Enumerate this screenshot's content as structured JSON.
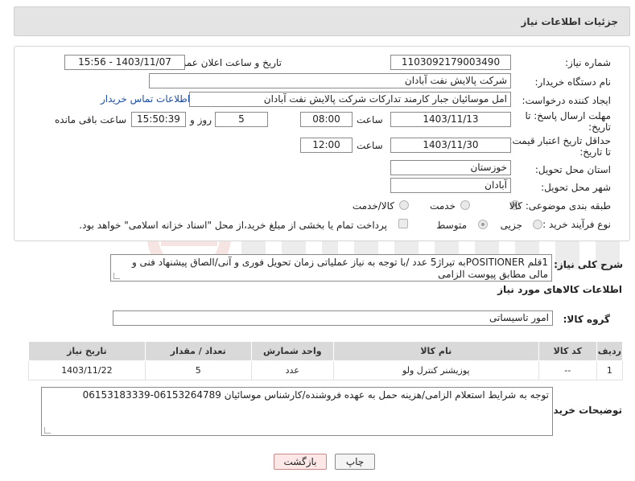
{
  "header": {
    "title": "جزئیات اطلاعات نیاز"
  },
  "form": {
    "need_number_label": "شماره نیاز:",
    "need_number": "1103092179003490",
    "announce_label": "تاریخ و ساعت اعلان عمومی:",
    "announce_value": "1403/11/07 - 15:56",
    "buyer_label": "نام دستگاه خریدار:",
    "buyer_value": "شرکت پالایش نفت آبادان",
    "requester_label": "ایجاد کننده درخواست:",
    "requester_value": "امل موسائیان جبار کارمند تدارکات شرکت پالایش نفت آبادان",
    "contact_link": "اطلاعات تماس خریدار",
    "deadline_label": "مهلت ارسال پاسخ: تا تاریخ:",
    "deadline_date": "1403/11/13",
    "time_label": "ساعت",
    "deadline_time": "08:00",
    "days_value": "5",
    "days_label": "روز و",
    "remaining_time": "15:50:39",
    "remaining_label": "ساعت باقی مانده",
    "validity_label": "حداقل تاریخ اعتبار قیمت: تا تاریخ:",
    "validity_date": "1403/11/30",
    "validity_time_label": "ساعت",
    "validity_time": "12:00",
    "province_label": "استان محل تحویل:",
    "province_value": "خوزستان",
    "city_label": "شهر محل تحویل:",
    "city_value": "آبادان",
    "category_label": "طبقه بندی موضوعی:",
    "category_options": [
      "کالا",
      "خدمت",
      "کالا/خدمت"
    ],
    "process_label": "نوع فرآیند خرید :",
    "process_options": [
      "جزیی",
      "متوسط"
    ],
    "payment_note": "پرداخت تمام یا بخشی از مبلغ خرید،از محل \"اسناد خزانه اسلامی\" خواهد بود."
  },
  "description": {
    "label": "شرح کلی نیاز:",
    "text": "1قلم POSITIONERبه تیراژ5 عدد /با توجه به نیاز عملیاتی زمان تحویل فوری و آنی/الصاق پیشنهاد فنی و مالی مطابق پیوست الزامی"
  },
  "goods_section": {
    "title": "اطلاعات کالاهای مورد نیاز",
    "group_label": "گروه کالا:",
    "group_value": "امور تاسیساتی"
  },
  "table": {
    "headers": [
      "ردیف",
      "کد کالا",
      "نام کالا",
      "واحد شمارش",
      "تعداد / مقدار",
      "تاریخ نیاز"
    ],
    "rows": [
      [
        "1",
        "--",
        "پوزیشنر کنترل ولو",
        "عدد",
        "5",
        "1403/11/22"
      ]
    ]
  },
  "buyer_notes": {
    "label": "توضیحات خریدار:",
    "text": "توجه به شرایط استعلام الزامی/هزینه حمل به عهده فروشنده/کارشناس موسائیان 06153264789-06153183339"
  },
  "buttons": {
    "print": "چاپ",
    "back": "بازگشت"
  },
  "colors": {
    "link": "#1a4ea8",
    "back_button_bg": "#fde7e7",
    "header_bg": "#e4e4e4",
    "table_header_bg": "#d9d9d9"
  }
}
